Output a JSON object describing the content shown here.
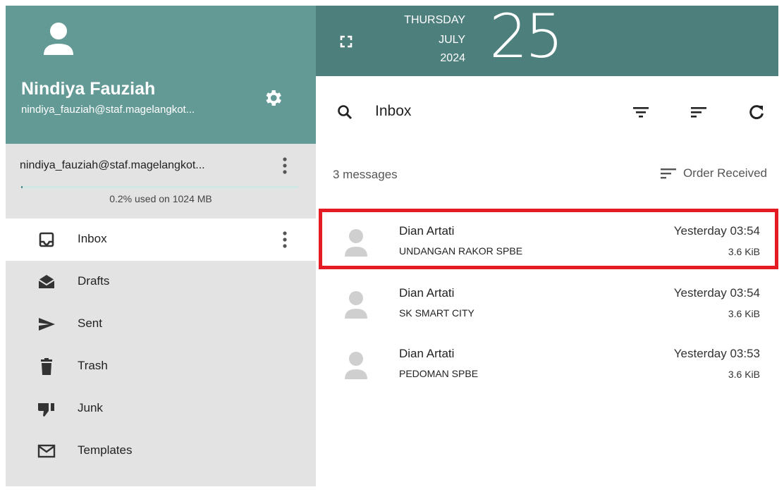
{
  "user": {
    "name": "Nindiya Fauziah",
    "email": "nindiya_fauziah@staf.magelangkot..."
  },
  "account": {
    "email": "nindiya_fauziah@staf.magelangkot...",
    "quota_text": "0.2% used on 1024 MB",
    "quota_fraction": 0.002
  },
  "folders": [
    {
      "label": "Inbox",
      "icon": "inbox-icon",
      "active": true
    },
    {
      "label": "Drafts",
      "icon": "drafts-envelope-open-icon"
    },
    {
      "label": "Sent",
      "icon": "send-icon"
    },
    {
      "label": "Trash",
      "icon": "trash-icon"
    },
    {
      "label": "Junk",
      "icon": "thumbs-down-icon"
    },
    {
      "label": "Templates",
      "icon": "envelope-outline-icon"
    }
  ],
  "date": {
    "weekday": "THURSDAY",
    "month": "JULY",
    "year": "2024",
    "day": "25"
  },
  "toolbar": {
    "folder_title": "Inbox"
  },
  "list": {
    "count_label": "3 messages",
    "order_label": "Order Received"
  },
  "messages": [
    {
      "sender": "Dian Artati",
      "subject": "UNDANGAN RAKOR SPBE",
      "time": "Yesterday 03:54",
      "size": "3.6 KiB",
      "highlighted": true
    },
    {
      "sender": "Dian Artati",
      "subject": "SK SMART CITY",
      "time": "Yesterday 03:54",
      "size": "3.6 KiB"
    },
    {
      "sender": "Dian Artati",
      "subject": "PEDOMAN SPBE",
      "time": "Yesterday 03:53",
      "size": "3.6 KiB"
    }
  ],
  "colors": {
    "sidebar_header": "#649a96",
    "topbar": "#4d7f7d",
    "sidebar_bg": "#e3e3e3",
    "highlight": "#e41b23"
  }
}
